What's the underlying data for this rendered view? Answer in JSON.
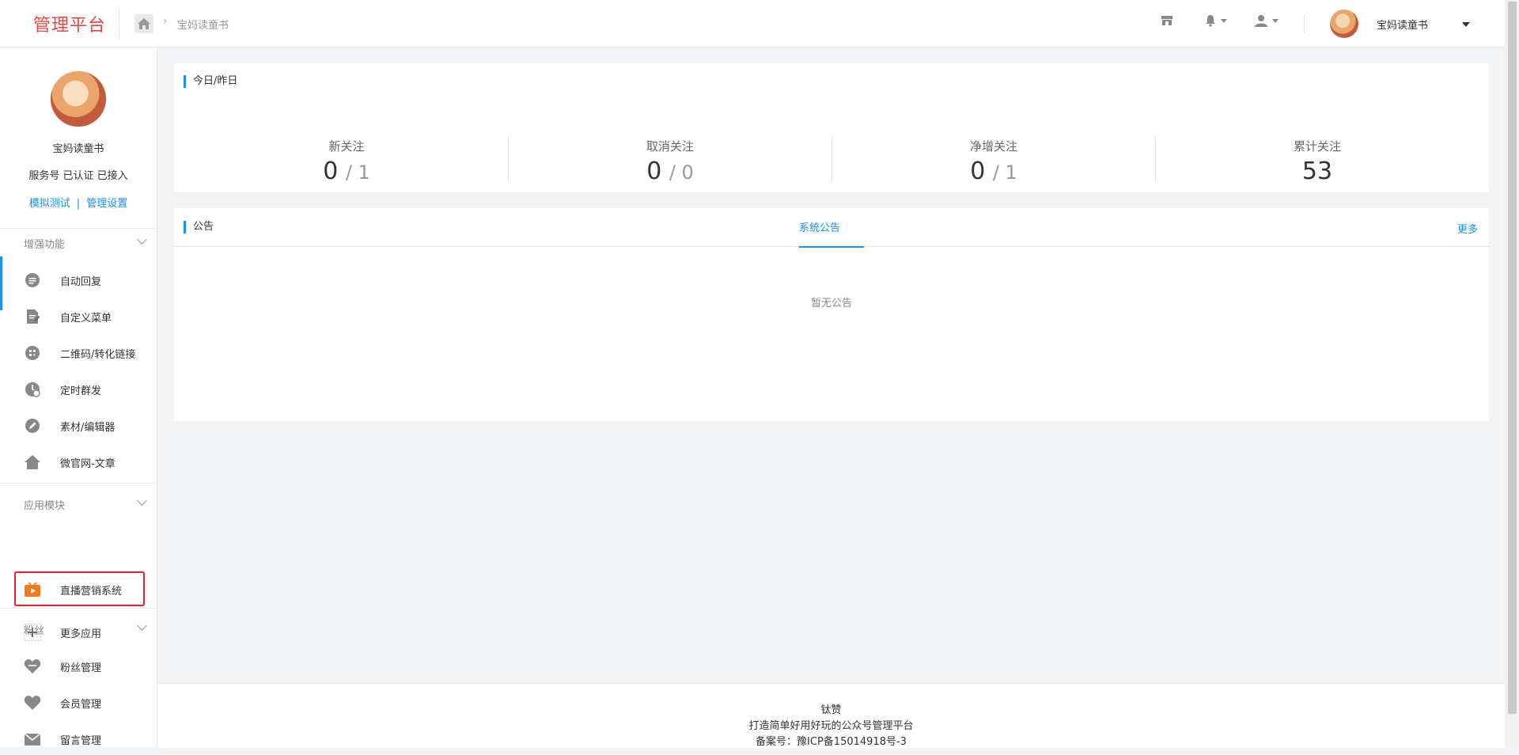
{
  "header": {
    "brand": "管理平台",
    "breadcrumb": "宝妈读童书",
    "username": "宝妈读童书"
  },
  "sidebar": {
    "account_name": "宝妈读童书",
    "account_status": "服务号 已认证 已接入",
    "link_test": "模拟测试",
    "link_separator": "|",
    "link_settings": "管理设置",
    "sections": {
      "enhance": "增强功能",
      "apps": "应用模块",
      "fans": "粉丝"
    },
    "enhance_items": [
      {
        "label": "自动回复",
        "icon": "chat-icon"
      },
      {
        "label": "自定义菜单",
        "icon": "document-edit-icon"
      },
      {
        "label": "二维码/转化链接",
        "icon": "qrcode-icon"
      },
      {
        "label": "定时群发",
        "icon": "clock-icon"
      },
      {
        "label": "素材/编辑器",
        "icon": "pencil-icon"
      },
      {
        "label": "微官网-文章",
        "icon": "home-icon"
      }
    ],
    "app_items": [
      {
        "label": "直播营销系统",
        "icon": "live-tv-icon"
      },
      {
        "label": "更多应用",
        "icon": "plus-icon"
      }
    ],
    "fans_items": [
      {
        "label": "粉丝管理",
        "icon": "heart-icon"
      },
      {
        "label": "会员管理",
        "icon": "heart-icon"
      },
      {
        "label": "留言管理",
        "icon": "mail-icon"
      }
    ]
  },
  "stats": {
    "title": "今日/昨日",
    "items": [
      {
        "label": "新关注",
        "today": "0",
        "yesterday": "/ 1"
      },
      {
        "label": "取消关注",
        "today": "0",
        "yesterday": "/ 0"
      },
      {
        "label": "净增关注",
        "today": "0",
        "yesterday": "/ 1"
      },
      {
        "label": "累计关注",
        "today": "53",
        "yesterday": ""
      }
    ]
  },
  "notice": {
    "title": "公告",
    "tab": "系统公告",
    "more": "更多",
    "empty": "暂无公告"
  },
  "footer": {
    "line1": "钛赞",
    "line2": "打造简单好用好玩的公众号管理平台",
    "line3": "备案号：豫ICP备15014918号-3"
  },
  "colors": {
    "brand": "#e5473f",
    "accent": "#1890ff",
    "highlight": "#e0242c",
    "live_icon": "#f57a1a"
  }
}
